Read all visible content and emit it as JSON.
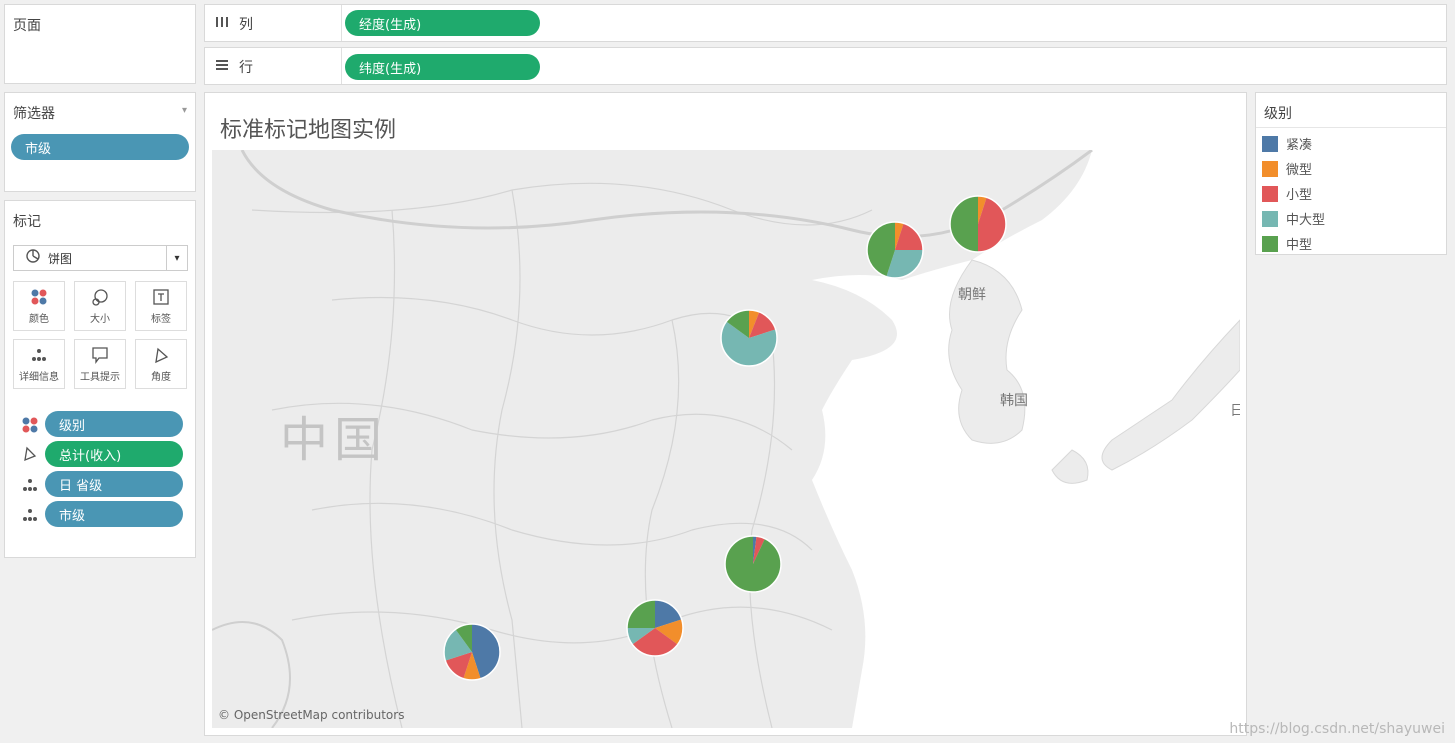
{
  "pages_panel": {
    "title": "页面"
  },
  "columns_shelf": {
    "icon": "columns-icon",
    "label": "列",
    "pill": "经度(生成)"
  },
  "rows_shelf": {
    "icon": "rows-icon",
    "label": "行",
    "pill": "纬度(生成)"
  },
  "filters_panel": {
    "title": "筛选器",
    "pill": "市级"
  },
  "marks_panel": {
    "title": "标记",
    "mark_type": "饼图",
    "buttons": [
      {
        "icon": "color-icon",
        "label": "颜色"
      },
      {
        "icon": "size-icon",
        "label": "大小"
      },
      {
        "icon": "label-icon",
        "label": "标签"
      },
      {
        "icon": "detail-icon",
        "label": "详细信息"
      },
      {
        "icon": "tooltip-icon",
        "label": "工具提示"
      },
      {
        "icon": "angle-icon",
        "label": "角度"
      }
    ],
    "fields": [
      {
        "icon": "color-icon",
        "label": "级别"
      },
      {
        "icon": "angle-icon",
        "label": "总计(收入)"
      },
      {
        "icon": "detail-icon",
        "label": "日 省级"
      },
      {
        "icon": "detail-icon",
        "label": "市级"
      }
    ]
  },
  "view": {
    "title": "标准标记地图实例",
    "map_labels": {
      "china": "中国",
      "north_korea": "朝鲜",
      "south_korea": "韩国",
      "japan_partial": "日"
    },
    "attribution": "© OpenStreetMap contributors"
  },
  "legend": {
    "title": "级别",
    "items": [
      {
        "label": "紧凑",
        "color": "#4e79a7"
      },
      {
        "label": "微型",
        "color": "#f28e2b"
      },
      {
        "label": "小型",
        "color": "#e15759"
      },
      {
        "label": "中大型",
        "color": "#76b7b2"
      },
      {
        "label": "中型",
        "color": "#59a14f"
      }
    ]
  },
  "chart_data": {
    "type": "pie",
    "series_names": [
      "紧凑",
      "微型",
      "小型",
      "中大型",
      "中型"
    ],
    "pies": [
      {
        "values": [
          0,
          0.05,
          0.45,
          0,
          0.5
        ]
      },
      {
        "values": [
          0,
          0.05,
          0.2,
          0.3,
          0.45
        ]
      },
      {
        "values": [
          0,
          0.06,
          0.14,
          0.65,
          0.15
        ]
      },
      {
        "values": [
          0.02,
          0,
          0.05,
          0,
          0.93
        ]
      },
      {
        "values": [
          0.2,
          0.15,
          0.3,
          0.1,
          0.25
        ]
      },
      {
        "values": [
          0.45,
          0.1,
          0.15,
          0.2,
          0.1
        ]
      }
    ]
  },
  "watermark": "https://blog.csdn.net/shayuwei"
}
